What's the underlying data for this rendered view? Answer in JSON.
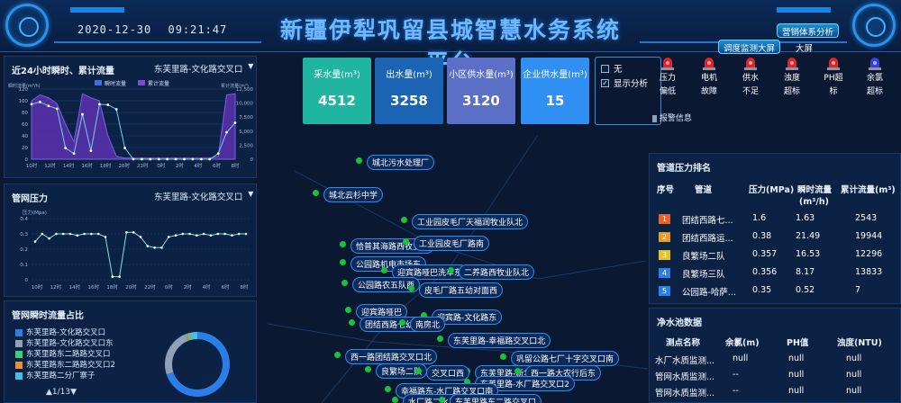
{
  "header": {
    "title": "新疆伊犁巩留县城智慧水务系统平台",
    "date": "2020-12-30",
    "time": "09:21:47",
    "btn_dispatch": "调度监测大屏",
    "btn_sales": "营销体系分析",
    "big_screen": "大屏"
  },
  "flow_panel": {
    "title": "近24小时瞬时、累计流量",
    "select_value": "东芙里路-文化路交叉口",
    "legend": [
      "瞬时流量",
      "累计流量"
    ],
    "left_unit": "瞬时流量(m³/h)",
    "right_unit": "累计流量(m³)",
    "x_labels": [
      "10时",
      "12时",
      "14时",
      "16时",
      "18时",
      "20时",
      "22时",
      "0时",
      "2时",
      "4时",
      "6时",
      "8时"
    ],
    "left_ticks": [
      "120",
      "100",
      "80",
      "60",
      "40",
      "20",
      "0"
    ],
    "right_ticks": [
      "12,500",
      "10,000",
      "7,500",
      "5,000",
      "2,500",
      "0"
    ]
  },
  "pressure_panel": {
    "title": "管网压力",
    "select_value": "东芙里路-文化路交叉口",
    "unit": "压力(Mpa)",
    "y_ticks": [
      "0.4",
      "0.3",
      "0.2",
      "0.1",
      "0"
    ],
    "x_labels": [
      "10时",
      "12时",
      "14时",
      "16时",
      "18时",
      "20时",
      "22时",
      "0时",
      "2时",
      "4时",
      "6时",
      "8时"
    ]
  },
  "share_panel": {
    "title": "管网瞬时流量占比",
    "legend": [
      {
        "label": "东芙里路-文化路交叉口",
        "color": "#2b7ee8"
      },
      {
        "label": "东芙里路-文化路交叉口东",
        "color": "#8fa0b8"
      },
      {
        "label": "东芙里路东二路路交叉口",
        "color": "#3ad17a"
      },
      {
        "label": "东芙里路东二路路交叉口2",
        "color": "#f08c3a"
      },
      {
        "label": "东芙里路二分厂寨子",
        "color": "#3ec2e8"
      }
    ],
    "pager": "1/13"
  },
  "stats": [
    {
      "label": "采水量(m³)",
      "value": "4512",
      "color": "#1fb5a0"
    },
    {
      "label": "出水量(m³)",
      "value": "3258",
      "color": "#1b63b3"
    },
    {
      "label": "小区供水量(m³)",
      "value": "3120",
      "color": "#5b6fc7"
    },
    {
      "label": "企业供水量(m³)",
      "value": "15",
      "color": "#2f8ff2"
    }
  ],
  "display_options": [
    {
      "label": "无",
      "checked": false
    },
    {
      "label": "显示分析",
      "checked": true
    }
  ],
  "alarms": [
    {
      "label": "压力偏低",
      "color": "#e0242a"
    },
    {
      "label": "电机故障",
      "color": "#e0242a"
    },
    {
      "label": "供水不足",
      "color": "#e0242a"
    },
    {
      "label": "浊度超标",
      "color": "#e0242a"
    },
    {
      "label": "PH超标",
      "color": "#e0242a"
    },
    {
      "label": "余氯超标",
      "color": "#3b3ee0"
    }
  ],
  "alarm_info_label": "报警信息",
  "map_labels": [
    "城北污水处理厂",
    "城北云杉中学",
    "工业园皮毛厂天福润牧业队北",
    "恰普其海路西牧业队",
    "工业园皮毛厂路南",
    "公园路机电市场东",
    "迎宾路哑巴洗车东",
    "公园路农五队西",
    "二养路西牧业队北",
    "皮毛厂路五幼对面西",
    "迎宾路哑巴",
    "团结西路七幼北",
    "迎宾路-文化路东",
    "南房北",
    "东芙里路-幸福路交叉口北",
    "西一路团结路交叉口北",
    "巩留公路七厂十字交叉口南",
    "良繁场二队",
    "东芙里路-新华路交叉口西",
    "西一路大农行后东",
    "交叉口西",
    "东芙里路-水厂路交叉口2",
    "幸福路东-水厂路交叉口南",
    "水厂路二水厂前",
    "东芙里路东二路交叉口"
  ],
  "pressure_rank": {
    "title": "管道压力排名",
    "headers": [
      "序号",
      "管道",
      "压力(MPa)",
      "瞬时流量",
      "累计流量(m³)"
    ],
    "flow_unit": "(m³/h)",
    "rows": [
      {
        "no": "1",
        "pipe": "团结西路七...",
        "pressure": "1.6",
        "flow": "1.63",
        "total": "2543",
        "color": "#e8622a"
      },
      {
        "no": "2",
        "pipe": "团结西路运...",
        "pressure": "0.38",
        "flow": "21.49",
        "total": "19944",
        "color": "#e89a2a"
      },
      {
        "no": "3",
        "pipe": "良繁场二队",
        "pressure": "0.357",
        "flow": "16.53",
        "total": "12296",
        "color": "#e8c22a"
      },
      {
        "no": "4",
        "pipe": "良繁场三队",
        "pressure": "0.356",
        "flow": "8.17",
        "total": "13833",
        "color": "#2a7fe8"
      },
      {
        "no": "5",
        "pipe": "公园路-哈萨...",
        "pressure": "0.35",
        "flow": "0.52",
        "total": "7",
        "color": "#2a7fe8"
      }
    ]
  },
  "water_quality": {
    "title": "净水池数据",
    "headers": [
      "测点名称",
      "余氯(m)",
      "PH值",
      "浊度(NTU)"
    ],
    "rows": [
      {
        "name": "水厂水质监测...",
        "chlorine": "null",
        "ph": "null",
        "turbidity": "null"
      },
      {
        "name": "管网水质监测...",
        "chlorine": "--",
        "ph": "null",
        "turbidity": "null"
      },
      {
        "name": "管网水质监测...",
        "chlorine": "--",
        "ph": "null",
        "turbidity": "null"
      }
    ]
  },
  "chart_data": [
    {
      "type": "line",
      "title": "近24小时瞬时、累计流量",
      "categories": [
        "10时",
        "12时",
        "14时",
        "16时",
        "18时",
        "20时",
        "22时",
        "0时",
        "2时",
        "4时",
        "6时",
        "8时"
      ],
      "series": [
        {
          "name": "瞬时流量",
          "axis": "left",
          "values": [
            100,
            110,
            105,
            95,
            60,
            30,
            112,
            105,
            100,
            40,
            5,
            2,
            2,
            2,
            2,
            2,
            2,
            2,
            2,
            2,
            2,
            2,
            5,
            110,
            112
          ]
        },
        {
          "name": "累计流量",
          "axis": "right",
          "values": [
            9800,
            10200,
            9500,
            9000,
            2000,
            1000,
            8000,
            1500,
            9800,
            9700,
            8900,
            2000,
            0,
            0,
            0,
            0,
            0,
            0,
            0,
            0,
            0,
            0,
            1000,
            4800,
            6500
          ]
        }
      ],
      "ylim_left": [
        0,
        120
      ],
      "ylim_right": [
        0,
        12500
      ]
    },
    {
      "type": "line",
      "title": "管网压力",
      "categories": [
        "10时",
        "12时",
        "14时",
        "16时",
        "18时",
        "20时",
        "22时",
        "0时",
        "2时",
        "4时",
        "6时",
        "8时"
      ],
      "series": [
        {
          "name": "压力",
          "values": [
            0.25,
            0.3,
            0.27,
            0.3,
            0.3,
            0.3,
            0.29,
            0.3,
            0.3,
            0.3,
            0.28,
            0.02,
            0.02,
            0.31,
            0.31,
            0.28,
            0.22,
            0.21,
            0.21,
            0.28,
            0.29,
            0.3,
            0.3,
            0.29,
            0.3,
            0.29,
            0.3,
            0.3,
            0.29,
            0.3,
            0.3
          ]
        }
      ],
      "ylim": [
        0,
        0.4
      ]
    },
    {
      "type": "pie",
      "title": "管网瞬时流量占比",
      "labels": [
        "东芙里路-文化路交叉口",
        "东芙里路-文化路交叉口东",
        "东芙里路东二路路交叉口",
        "东芙里路东二路路交叉口2",
        "东芙里路二分厂寨子"
      ],
      "values": [
        70,
        24,
        1,
        1,
        4
      ]
    }
  ]
}
